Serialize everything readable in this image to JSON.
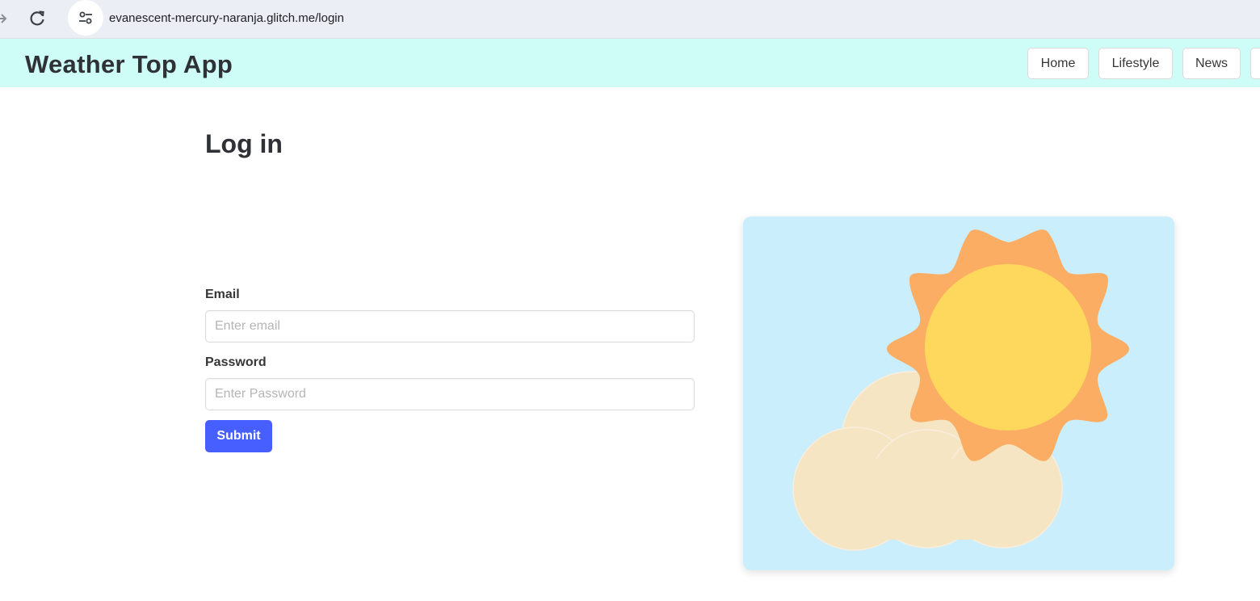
{
  "browser": {
    "url": "evanescent-mercury-naranja.glitch.me/login"
  },
  "navbar": {
    "brand": "Weather Top App",
    "items": [
      {
        "label": "Home"
      },
      {
        "label": "Lifestyle"
      },
      {
        "label": "News"
      }
    ]
  },
  "login": {
    "title": "Log in",
    "email_label": "Email",
    "email_placeholder": "Enter email",
    "password_label": "Password",
    "password_placeholder": "Enter Password",
    "submit_label": "Submit"
  },
  "illustration": {
    "icon": "sun-behind-cloud-icon",
    "colors": {
      "background": "#cbeefc",
      "sun_rays": "#fbad63",
      "sun_core": "#fdd85c",
      "cloud": "#f5e5c3"
    }
  },
  "colors": {
    "navbar_bg": "#cefcf6",
    "primary": "#485fff"
  }
}
